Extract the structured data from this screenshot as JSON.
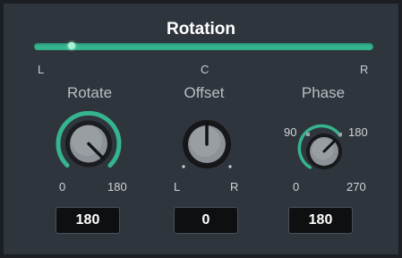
{
  "title": "Rotation",
  "colors": {
    "accent": "#35b48e",
    "panel": "#2f353d",
    "value_box": "#0e0f11"
  },
  "slider": {
    "position_fraction": 0.11,
    "labels": {
      "left": "L",
      "center": "C",
      "right": "R"
    }
  },
  "rotate": {
    "label": "Rotate",
    "min_label": "0",
    "max_label": "180",
    "value": "180",
    "fraction": 1.0
  },
  "offset": {
    "label": "Offset",
    "min_label": "L",
    "max_label": "R",
    "value": "0",
    "fraction": 0.5
  },
  "phase": {
    "label": "Phase",
    "tick_labels": {
      "top_left": "90",
      "top_right": "180",
      "bottom_left": "0",
      "bottom_right": "270"
    },
    "value": "180",
    "fraction": 0.667
  }
}
